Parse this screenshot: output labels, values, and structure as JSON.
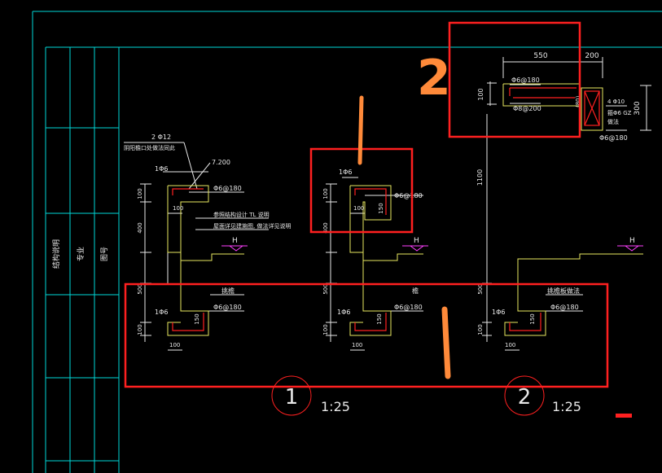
{
  "title_block": {
    "cells": [
      "结构说明",
      "专业",
      "图号"
    ]
  },
  "sections": {
    "top": {
      "dims": {
        "width": "550",
        "side": "200",
        "height": "300",
        "left": "100",
        "bar": "(80)"
      },
      "labels": {
        "rebar_top": "Φ6@180",
        "rebar_mid": "Φ8@200",
        "rebar_right_1": "4 Φ10",
        "rebar_right_2": "箍Φ6 GZ",
        "rebar_right_3": "做法",
        "rebar_bottom": "Φ6@180",
        "height_1100": "1100"
      }
    },
    "left_detail": {
      "note_top": "2 Φ12",
      "note_top_2": "阴阳檐口处做法同此",
      "note_side": "7.200",
      "bar_label": "1Φ6",
      "rebar": "Φ6@180",
      "dim_100": "100",
      "dim_400": "400",
      "dim_500": "500",
      "text_mid_1": "参照结构设计 TL 说明",
      "text_mid_2": "屋面详见建施图, 做法详见说明",
      "H": "H",
      "lower_label": "挑檐",
      "dim_150": "150"
    },
    "mid_detail": {
      "bar_label": "1Φ6",
      "rebar": "Φ6@180",
      "dim_100": "100",
      "dim_150": "150",
      "dim_400": "400",
      "dim_500": "500",
      "H": "H",
      "lower_label": "檐"
    },
    "right_detail": {
      "bar_label": "1Φ6",
      "rebar": "Φ6@180",
      "dim_100": "100",
      "dim_150": "150",
      "dim_500": "500",
      "H": "H",
      "lower_label": "挑檐板做法"
    }
  },
  "callouts": {
    "one_small": "1",
    "two_big": "2",
    "one_big": "1",
    "circle_1": "1",
    "circle_2": "2",
    "scale_1": "1:25",
    "scale_2": "1:25"
  },
  "colors": {
    "frame": "#00d8d8",
    "red": "#ff2020",
    "yellow": "#e8e860",
    "white": "#e8e8e8",
    "magenta": "#ff40ff",
    "orange": "#ff8a3a"
  }
}
